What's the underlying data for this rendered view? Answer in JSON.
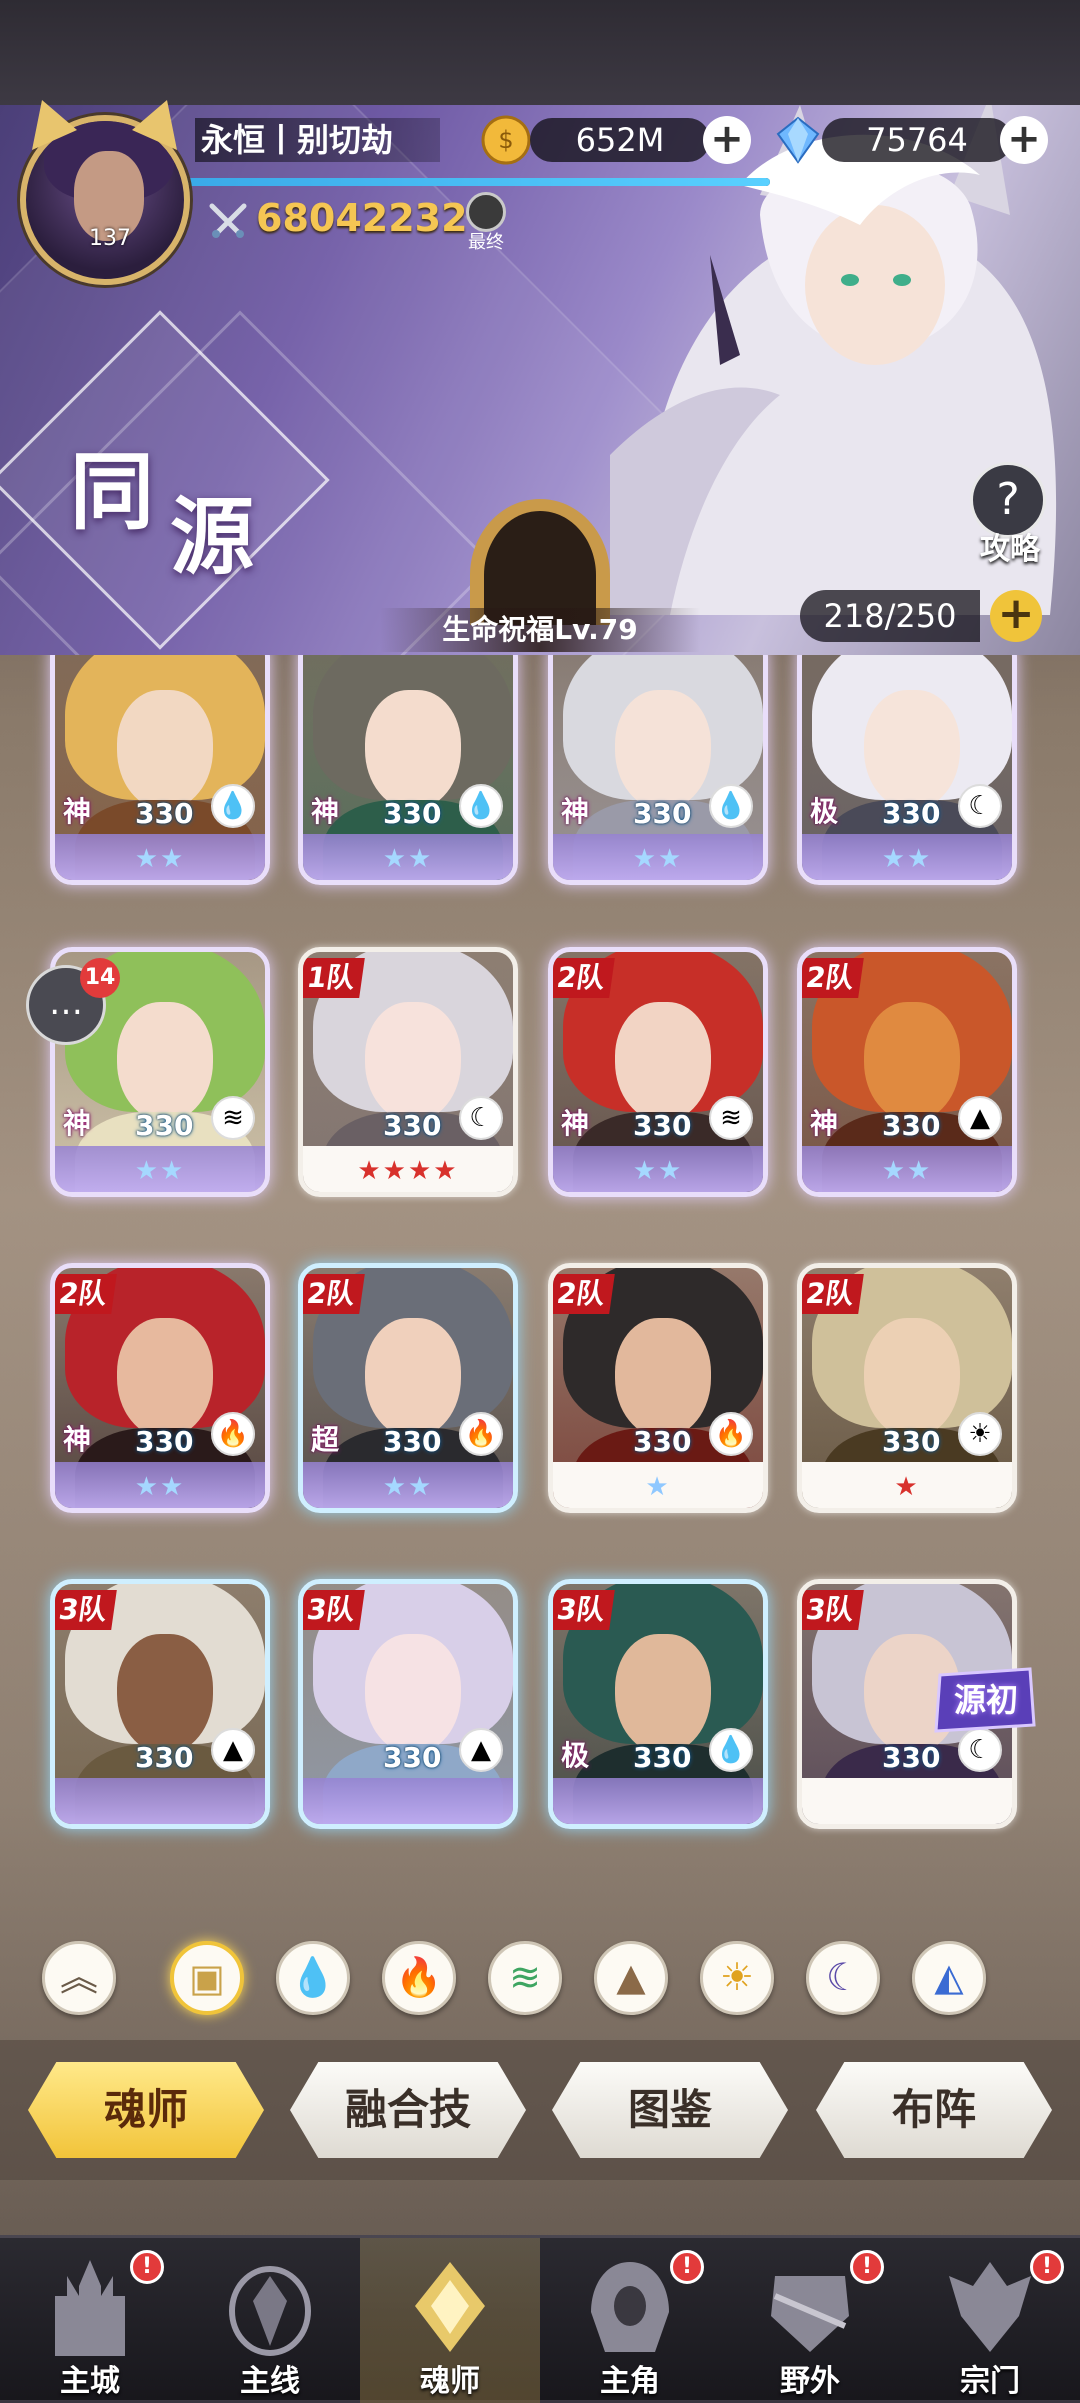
{
  "player": {
    "name": "永恒丨别切劫",
    "level": "137",
    "power": "68042232",
    "final_label": "最终",
    "exp_progress": 1.0
  },
  "resources": {
    "gold": "652M",
    "diamond": "75764"
  },
  "banner": {
    "title_char_1": "同",
    "title_char_2": "源",
    "guide_label": "攻略",
    "blessing": "生命祝福Lv.79",
    "capacity": "218/250"
  },
  "chat": {
    "count": "14"
  },
  "cards": [
    {
      "tier": "神",
      "level": "330",
      "element": "water",
      "element_glyph": "💧",
      "stars": "★★",
      "star_color": "#a5d8ff",
      "team": ""
    },
    {
      "tier": "神",
      "level": "330",
      "element": "water",
      "element_glyph": "💧",
      "stars": "★★",
      "star_color": "#a5d8ff",
      "team": ""
    },
    {
      "tier": "神",
      "level": "330",
      "element": "water",
      "element_glyph": "💧",
      "stars": "★★",
      "star_color": "#a5d8ff",
      "team": ""
    },
    {
      "tier": "极",
      "level": "330",
      "element": "moon",
      "element_glyph": "☾",
      "stars": "★★",
      "star_color": "#a5d8ff",
      "team": ""
    },
    {
      "tier": "神",
      "level": "330",
      "element": "wind",
      "element_glyph": "≋",
      "stars": "★★",
      "star_color": "#a5d8ff",
      "team": ""
    },
    {
      "tier": "",
      "level": "330",
      "element": "moon",
      "element_glyph": "☾",
      "stars": "★★★★",
      "star_color": "#d8312c",
      "team": "1队"
    },
    {
      "tier": "神",
      "level": "330",
      "element": "wind",
      "element_glyph": "≋",
      "stars": "★★",
      "star_color": "#a5d8ff",
      "team": "2队"
    },
    {
      "tier": "神",
      "level": "330",
      "element": "mountain",
      "element_glyph": "▲",
      "stars": "★★",
      "star_color": "#a5d8ff",
      "team": "2队"
    },
    {
      "tier": "神",
      "level": "330",
      "element": "fire",
      "element_glyph": "🔥",
      "stars": "★★",
      "star_color": "#a5d8ff",
      "team": "2队"
    },
    {
      "tier": "超",
      "level": "330",
      "element": "fire",
      "element_glyph": "🔥",
      "stars": "★★",
      "star_color": "#a5d8ff",
      "team": "2队"
    },
    {
      "tier": "",
      "level": "330",
      "element": "fire",
      "element_glyph": "🔥",
      "stars": "★",
      "star_color": "#8fc8ff",
      "team": "2队"
    },
    {
      "tier": "",
      "level": "330",
      "element": "sun",
      "element_glyph": "☀",
      "stars": "★",
      "star_color": "#d8312c",
      "team": "2队"
    },
    {
      "tier": "",
      "level": "330",
      "element": "mountain",
      "element_glyph": "▲",
      "stars": "",
      "star_color": "#a5d8ff",
      "team": "3队"
    },
    {
      "tier": "",
      "level": "330",
      "element": "mountain",
      "element_glyph": "▲",
      "stars": "",
      "star_color": "#a5d8ff",
      "team": "3队"
    },
    {
      "tier": "极",
      "level": "330",
      "element": "water",
      "element_glyph": "💧",
      "stars": "",
      "star_color": "#a5d8ff",
      "team": "3队"
    },
    {
      "tier": "",
      "level": "330",
      "element": "moon",
      "element_glyph": "☾",
      "stars": "",
      "star_color": "#a5d8ff",
      "team": "3队"
    }
  ],
  "source_badge": "源初",
  "filters": [
    {
      "name": "filter-rank-icon",
      "glyph": "︽",
      "color": "#6a5a48"
    },
    {
      "name": "filter-all-icon",
      "glyph": "▣",
      "color": "#c9a24a"
    },
    {
      "name": "filter-water-icon",
      "glyph": "💧",
      "color": "#2a7cd3"
    },
    {
      "name": "filter-fire-icon",
      "glyph": "🔥",
      "color": "#d8312c"
    },
    {
      "name": "filter-wind-icon",
      "glyph": "≋",
      "color": "#3ea561"
    },
    {
      "name": "filter-mountain-icon",
      "glyph": "▲",
      "color": "#8b6a48"
    },
    {
      "name": "filter-sun-icon",
      "glyph": "☀",
      "color": "#e0a21e"
    },
    {
      "name": "filter-moon-icon",
      "glyph": "☾",
      "color": "#5b4aa8"
    },
    {
      "name": "filter-special-icon",
      "glyph": "◭",
      "color": "#3a6bd3"
    }
  ],
  "tabs": [
    {
      "label": "魂师",
      "active": true
    },
    {
      "label": "融合技",
      "active": false
    },
    {
      "label": "图鉴",
      "active": false
    },
    {
      "label": "布阵",
      "active": false
    }
  ],
  "nav": [
    {
      "label": "主城",
      "alert": "!",
      "icon": "castle-icon"
    },
    {
      "label": "主线",
      "alert": "",
      "icon": "mainline-icon"
    },
    {
      "label": "魂师",
      "alert": "",
      "icon": "soul-master-icon",
      "active": true
    },
    {
      "label": "主角",
      "alert": "!",
      "icon": "hero-icon"
    },
    {
      "label": "野外",
      "alert": "!",
      "icon": "wild-icon"
    },
    {
      "label": "宗门",
      "alert": "!",
      "icon": "sect-icon"
    }
  ]
}
